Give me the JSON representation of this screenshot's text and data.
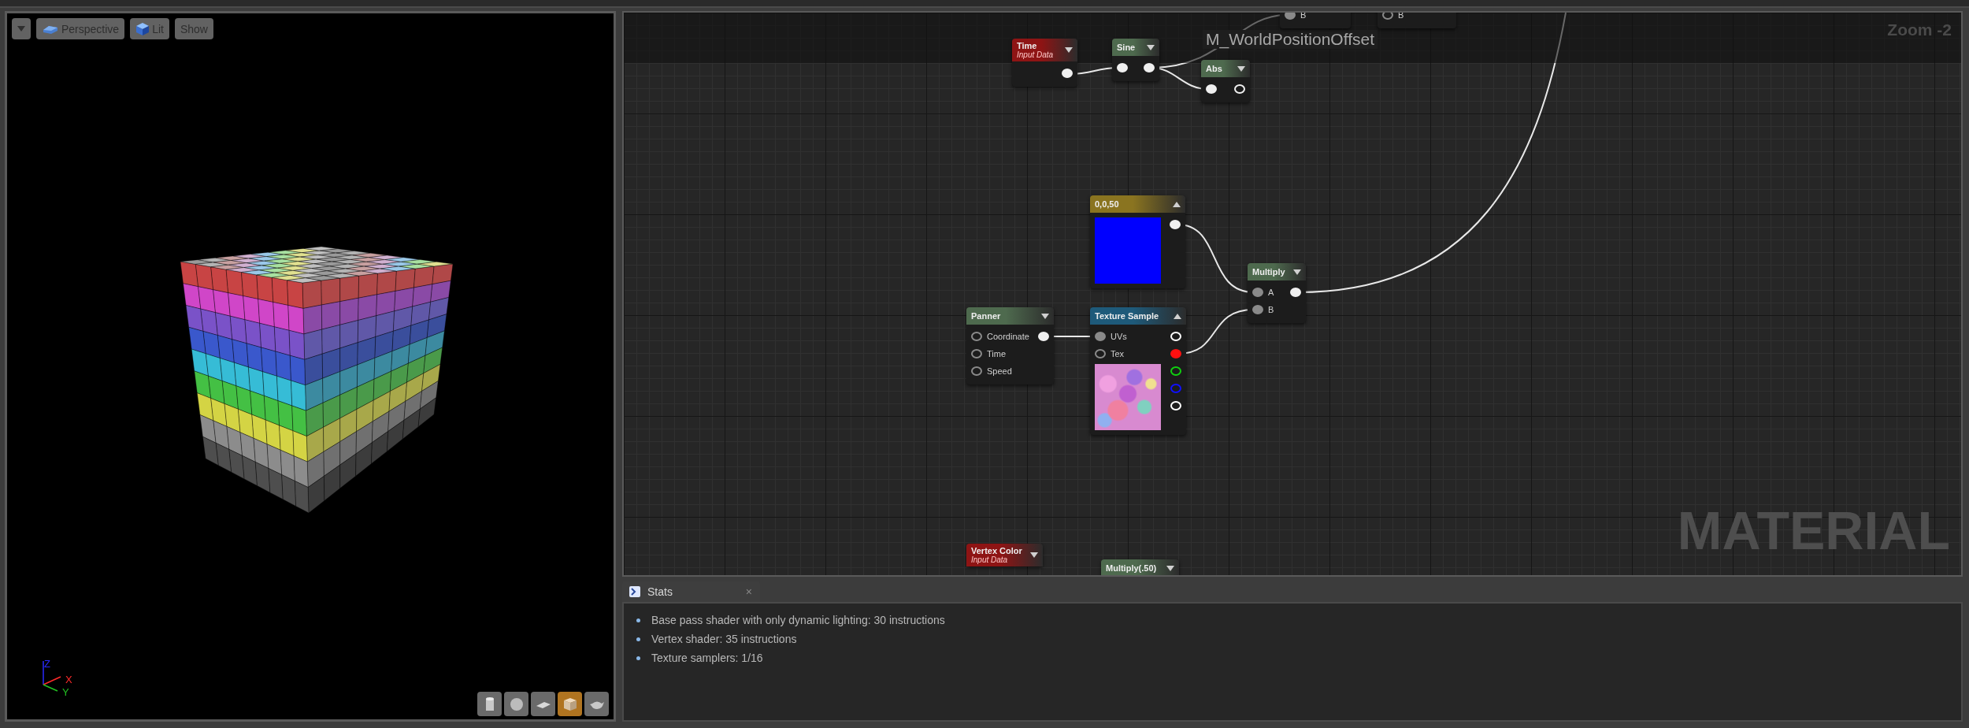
{
  "viewport": {
    "toolbar": [
      {
        "kind": "menu"
      },
      {
        "kind": "view",
        "label": "Perspective"
      },
      {
        "kind": "lighting",
        "label": "Lit"
      },
      {
        "kind": "text",
        "label": "Show"
      }
    ],
    "axes": [
      {
        "label": "Z",
        "color": "#2a2aff"
      },
      {
        "label": "X",
        "color": "#ff2a2a"
      },
      {
        "label": "Y",
        "color": "#22c022"
      }
    ],
    "preview_shapes": [
      {
        "kind": "cylinder",
        "selected": false
      },
      {
        "kind": "sphere",
        "selected": false
      },
      {
        "kind": "plane",
        "selected": false
      },
      {
        "kind": "cube",
        "selected": true
      },
      {
        "kind": "teapot",
        "selected": false
      }
    ]
  },
  "graph": {
    "title": "M_WorldPositionOffset",
    "zoom": "Zoom -2",
    "watermark": "MATERIAL",
    "nodes": [
      {
        "kind": "partial",
        "inputs": [
          {
            "label": "B",
            "connected": true
          }
        ]
      },
      {
        "kind": "partial",
        "inputs": [
          {
            "label": "B",
            "connected": false
          }
        ]
      },
      {
        "kind": "expression",
        "title": "Time",
        "subtitle": "Input Data",
        "color": "#8e1414",
        "preview_expanded": false,
        "outputs": [
          {
            "connected": true
          }
        ]
      },
      {
        "kind": "expression",
        "title": "Sine",
        "color": "#4e6a4e",
        "preview_expanded": false,
        "inputs": [
          {
            "connected": true
          }
        ],
        "outputs": [
          {
            "connected": true
          }
        ]
      },
      {
        "kind": "expression",
        "title": "Abs",
        "color": "#4e6a4e",
        "preview_expanded": false,
        "inputs": [
          {
            "connected": true
          }
        ],
        "outputs": [
          {
            "connected": false
          }
        ]
      },
      {
        "kind": "constant",
        "title": "0,0,50",
        "color": "#8a7420",
        "preview_expanded": true,
        "outputs": [
          {
            "connected": true
          }
        ]
      },
      {
        "kind": "expression",
        "title": "Multiply",
        "color": "#4e6a4e",
        "preview_expanded": false,
        "inputs": [
          {
            "label": "A",
            "connected": true
          },
          {
            "label": "B",
            "connected": true
          }
        ],
        "outputs": [
          {
            "connected": true
          }
        ]
      },
      {
        "kind": "expression",
        "title": "Panner",
        "color": "#4e6a4e",
        "preview_expanded": false,
        "inputs": [
          {
            "label": "Coordinate",
            "connected": false
          },
          {
            "label": "Time",
            "connected": false
          },
          {
            "label": "Speed",
            "connected": false
          }
        ],
        "outputs": [
          {
            "connected": true
          }
        ]
      },
      {
        "kind": "texture",
        "title": "Texture Sample",
        "color": "#1e5a7a",
        "preview_expanded": true,
        "inputs": [
          {
            "label": "UVs",
            "connected": true
          },
          {
            "label": "Tex",
            "connected": false
          }
        ],
        "outputs": [
          {
            "connected": false,
            "color": "#ffffff"
          },
          {
            "connected": true,
            "color": "#ff1010"
          },
          {
            "connected": false,
            "color": "#10d010"
          },
          {
            "connected": false,
            "color": "#1010ff"
          },
          {
            "connected": false,
            "color": "#ffffff"
          }
        ]
      },
      {
        "kind": "expression",
        "title": "Vertex Color",
        "subtitle": "Input Data",
        "color": "#8e1414",
        "preview_expanded": false
      },
      {
        "kind": "expression",
        "title": "Multiply(.50)",
        "color": "#4e6a4e",
        "preview_expanded": false
      }
    ]
  },
  "stats": {
    "tab": {
      "label": "Stats",
      "close": "×"
    },
    "lines": [
      "Base pass shader with only dynamic lighting: 30 instructions",
      "Vertex shader: 35 instructions",
      "Texture samplers: 1/16"
    ]
  }
}
